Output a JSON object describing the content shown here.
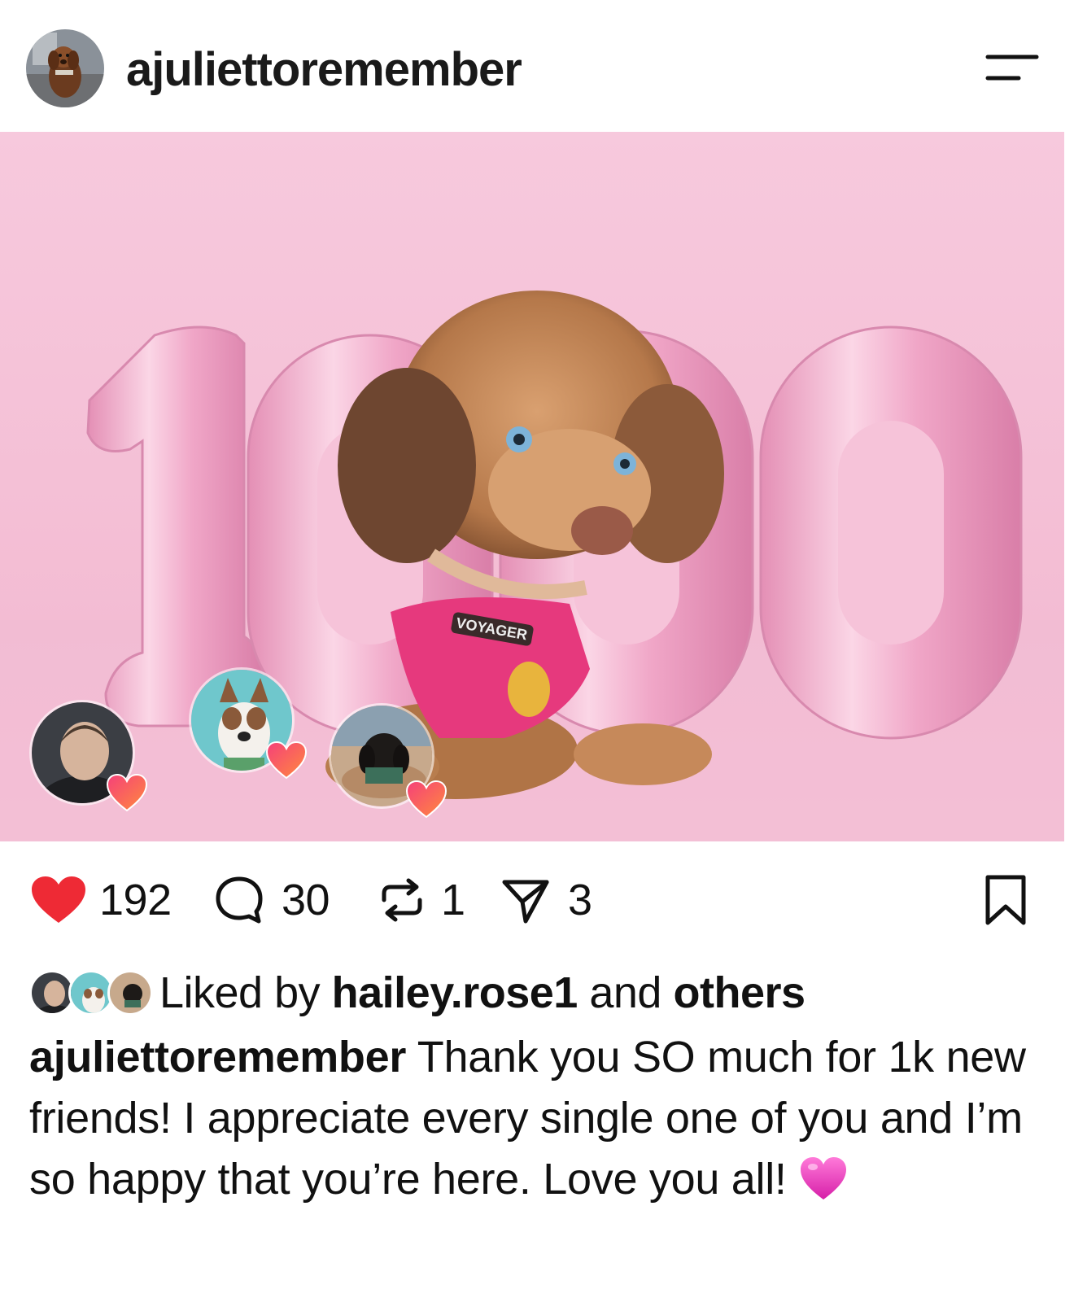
{
  "header": {
    "username": "ajuliettoremember",
    "avatar_icon": "dachshund-avatar",
    "menu_icon": "menu-lines-icon"
  },
  "photo": {
    "balloon_text": "1000",
    "harness_label": "VOYAGER",
    "tagged_avatars": [
      {
        "name": "person-avatar",
        "reaction": "heart"
      },
      {
        "name": "collie-dog-avatar",
        "reaction": "heart"
      },
      {
        "name": "black-dachshund-avatar",
        "reaction": "heart"
      }
    ],
    "colors": {
      "background": "#f6c6dc",
      "balloons": "#f2a9c9",
      "harness": "#e6397d"
    }
  },
  "actions": {
    "likes": "192",
    "comments": "30",
    "reposts": "1",
    "shares": "3",
    "like_icon": "heart-filled-icon",
    "comment_icon": "speech-bubble-icon",
    "repost_icon": "repost-arrows-icon",
    "share_icon": "paper-plane-icon",
    "save_icon": "bookmark-icon",
    "like_color": "#ee2a35"
  },
  "liked_by": {
    "prefix": "Liked by",
    "user": "hailey.rose1",
    "middle": "and",
    "suffix": "others"
  },
  "caption": {
    "user": "ajuliettoremember",
    "text": "Thank you SO much for 1k new friends! I appreciate every single one of you and I’m so happy that you’re here. Love you all!",
    "emoji": "pink-heart-emoji"
  }
}
